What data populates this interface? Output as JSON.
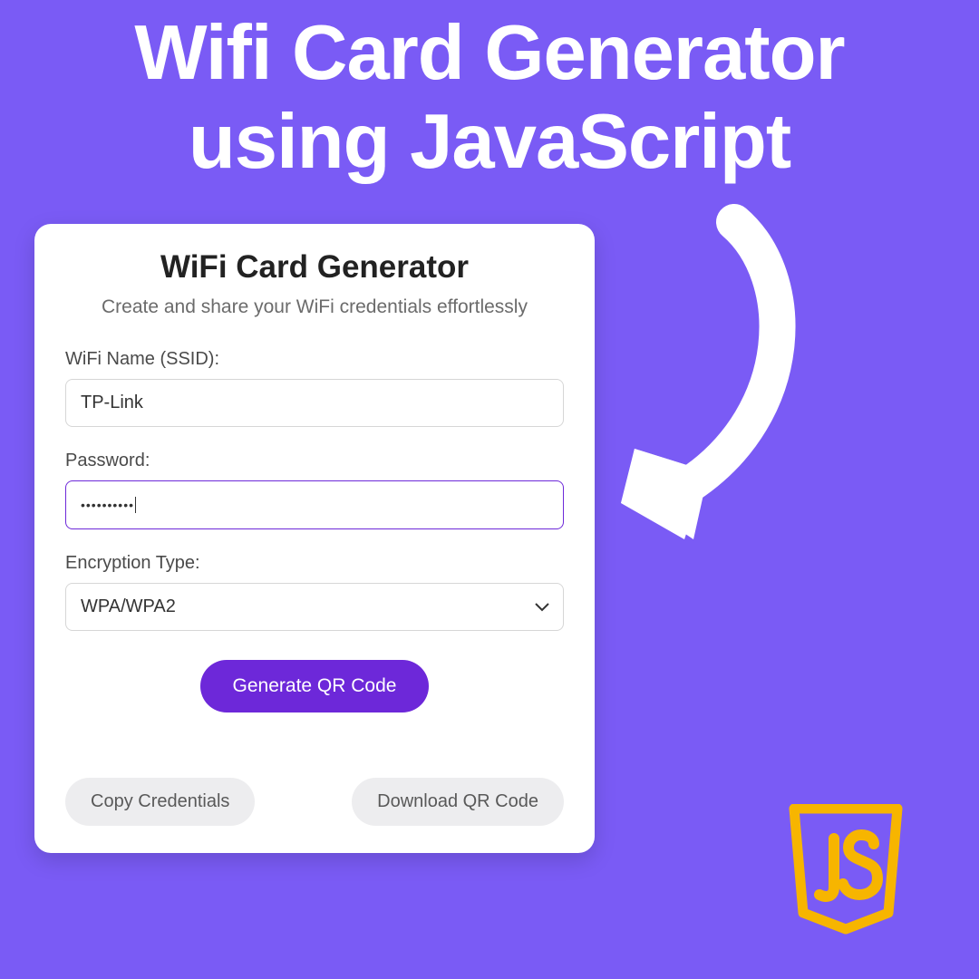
{
  "hero": {
    "line1": "Wifi Card Generator",
    "line2": "using JavaScript"
  },
  "card": {
    "title": "WiFi Card Generator",
    "subtitle": "Create and share your WiFi credentials effortlessly",
    "ssid_label": "WiFi Name (SSID):",
    "ssid_value": "TP-Link",
    "password_label": "Password:",
    "password_masked": "••••••••••",
    "encryption_label": "Encryption Type:",
    "encryption_value": "WPA/WPA2",
    "generate_label": "Generate QR Code",
    "copy_label": "Copy Credentials",
    "download_label": "Download QR Code"
  },
  "colors": {
    "bg": "#7a5bf5",
    "primary": "#6d28d9",
    "js_yellow": "#f7b500"
  }
}
